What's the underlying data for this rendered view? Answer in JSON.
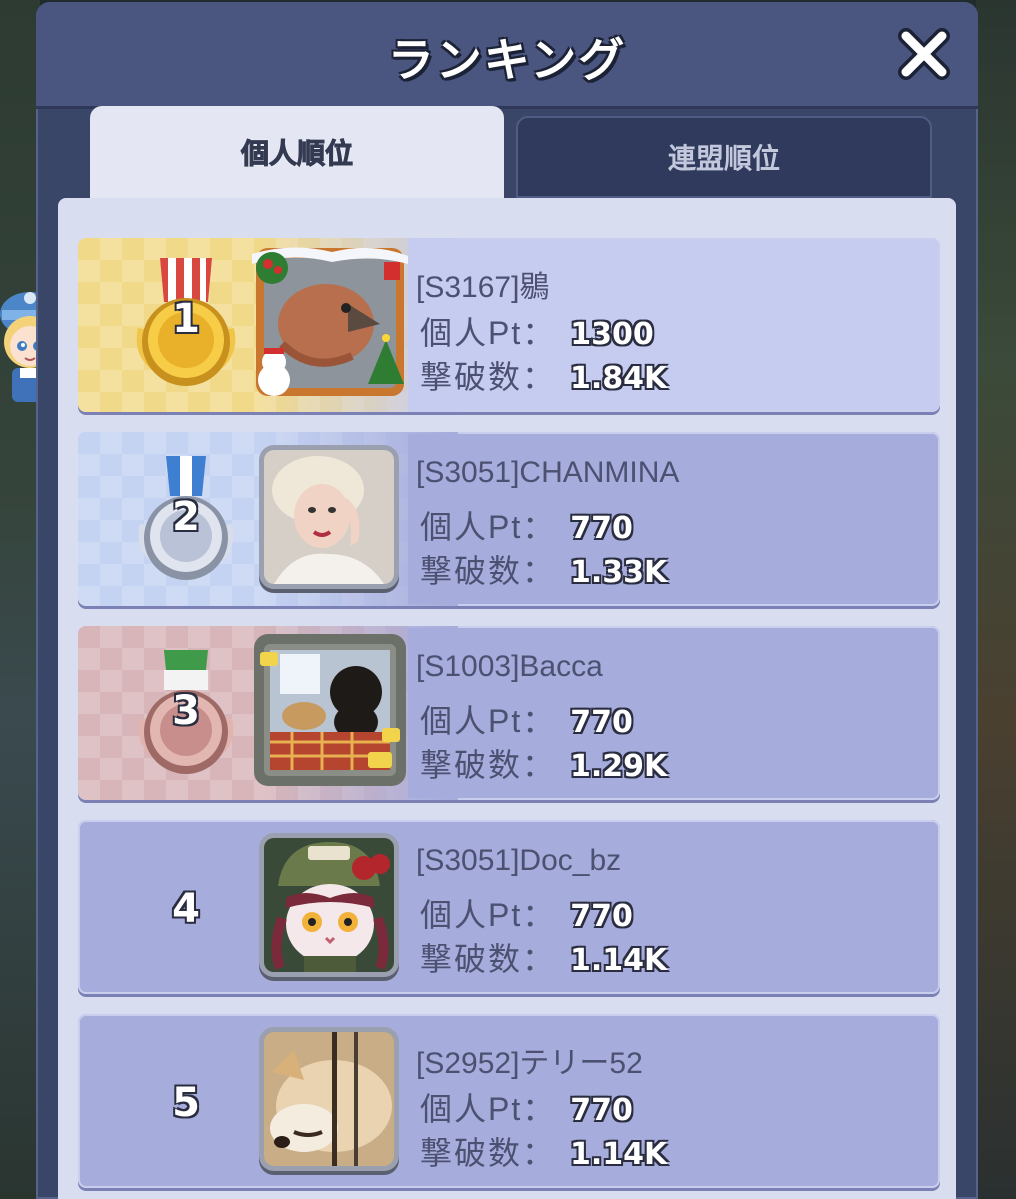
{
  "header": {
    "title": "ランキング"
  },
  "tabs": [
    {
      "label": "個人順位",
      "active": true
    },
    {
      "label": "連盟順位",
      "active": false
    }
  ],
  "labels": {
    "points": "個人Pt：",
    "kills": "撃破数："
  },
  "rankings": [
    {
      "rank": "1",
      "name": "[S3167]鶍",
      "points": "1300",
      "kills": "1.84K",
      "medal": "gold-medal-icon",
      "avatar": "crossbill-bird-avatar"
    },
    {
      "rank": "2",
      "name": "[S3051]CHANMINA",
      "points": "770",
      "kills": "1.33K",
      "medal": "silver-medal-icon",
      "avatar": "woman-portrait-avatar"
    },
    {
      "rank": "3",
      "name": "[S1003]Bacca",
      "points": "770",
      "kills": "1.29K",
      "medal": "bronze-medal-icon",
      "avatar": "dogs-on-sofa-avatar"
    },
    {
      "rank": "4",
      "name": "[S3051]Doc_bz",
      "points": "770",
      "kills": "1.14K",
      "medal": null,
      "avatar": "cat-soldier-avatar"
    },
    {
      "rank": "5",
      "name": "[S2952]テリー52",
      "points": "770",
      "kills": "1.14K",
      "medal": null,
      "avatar": "shiba-dog-avatar"
    }
  ],
  "colors": {
    "gold": "#e9b92c",
    "silver": "#b9c2d6",
    "bronze": "#c78e8c",
    "row": "#a6acdb",
    "panel": "#3a4668"
  }
}
